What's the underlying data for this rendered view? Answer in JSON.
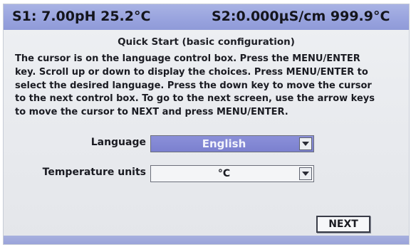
{
  "status_bar": {
    "sensor1": "S1: 7.00pH  25.2°C",
    "sensor2": "S2:0.000µS/cm 999.9°C"
  },
  "screen": {
    "title": "Quick Start (basic configuration)",
    "instructions": [
      "The cursor is on the language control box. Press the MENU/ENTER",
      "key. Scroll up or down to display the choices. Press MENU/ENTER to",
      "select the desired language. Press the down key to move the cursor",
      "to the next control box. To go to the next screen, use the arrow keys",
      "to move the cursor to NEXT and press MENU/ENTER."
    ]
  },
  "fields": {
    "language": {
      "label": "Language",
      "value": "English"
    },
    "temperature_units": {
      "label": "Temperature units",
      "value": "°C"
    }
  },
  "buttons": {
    "next": "NEXT"
  },
  "colors": {
    "status_bar": "#98a3de",
    "selected_field": "#7b80cf",
    "screen_background": "#e8eaee"
  }
}
